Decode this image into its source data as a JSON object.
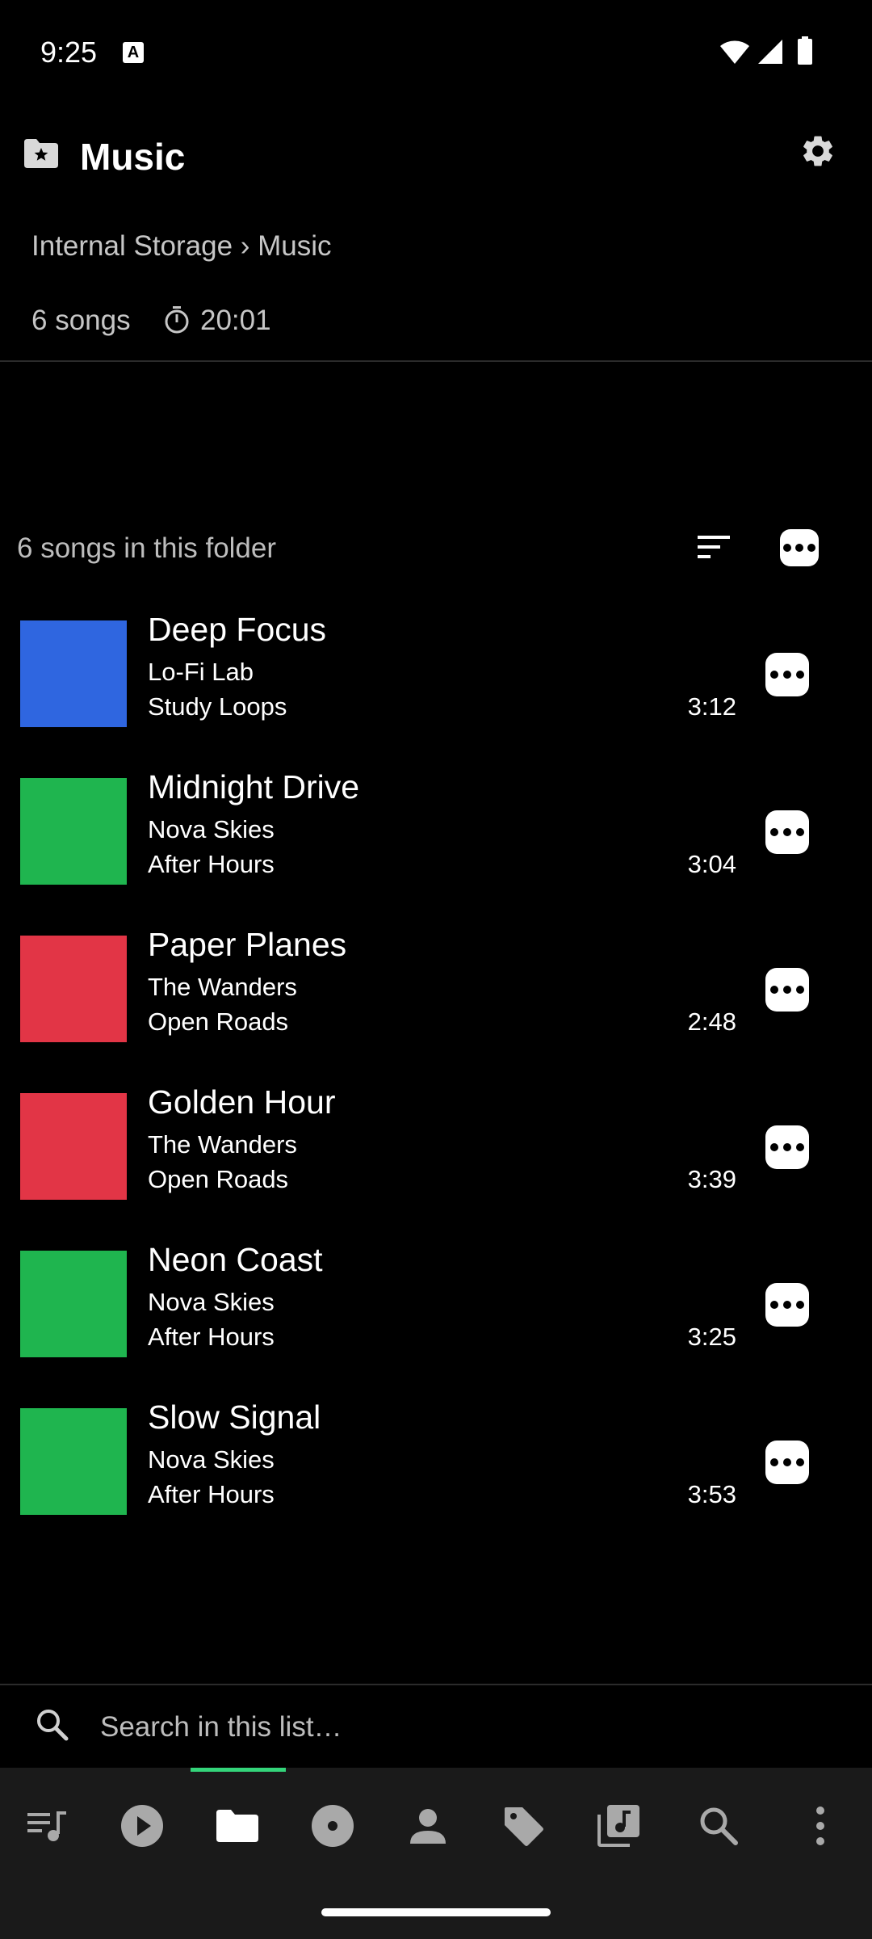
{
  "status_bar": {
    "time": "9:25",
    "notification_icon": "text-a-icon",
    "icons": [
      "wifi-icon",
      "signal-icon",
      "battery-icon"
    ]
  },
  "header": {
    "icon": "folder-star-icon",
    "title": "Music",
    "settings_icon": "gear-icon",
    "breadcrumb": "Internal Storage › Music",
    "song_count": "6 songs",
    "total_duration": "20:01"
  },
  "list_header": {
    "label": "6 songs in this folder",
    "sort_icon": "sort-icon",
    "more_icon": "more-icon"
  },
  "songs": [
    {
      "title": "Deep Focus",
      "artist": "Lo-Fi Lab",
      "album": "Study Loops",
      "duration": "3:12",
      "cover_color": "#2f66e0"
    },
    {
      "title": "Midnight Drive",
      "artist": "Nova Skies",
      "album": "After Hours",
      "duration": "3:04",
      "cover_color": "#1fb54f"
    },
    {
      "title": "Paper Planes",
      "artist": "The Wanders",
      "album": "Open Roads",
      "duration": "2:48",
      "cover_color": "#e23546"
    },
    {
      "title": "Golden Hour",
      "artist": "The Wanders",
      "album": "Open Roads",
      "duration": "3:39",
      "cover_color": "#e23546"
    },
    {
      "title": "Neon Coast",
      "artist": "Nova Skies",
      "album": "After Hours",
      "duration": "3:25",
      "cover_color": "#1fb54f"
    },
    {
      "title": "Slow Signal",
      "artist": "Nova Skies",
      "album": "After Hours",
      "duration": "3:53",
      "cover_color": "#1fb54f"
    }
  ],
  "search": {
    "placeholder": "Search in this list…"
  },
  "bottom_nav": {
    "items": [
      "queue-icon",
      "play-icon",
      "folder-icon",
      "album-icon",
      "artist-icon",
      "tag-icon",
      "playlist-icon",
      "search-icon",
      "overflow-menu-icon"
    ],
    "active": "folder-icon",
    "accent_color": "#34d47a"
  }
}
